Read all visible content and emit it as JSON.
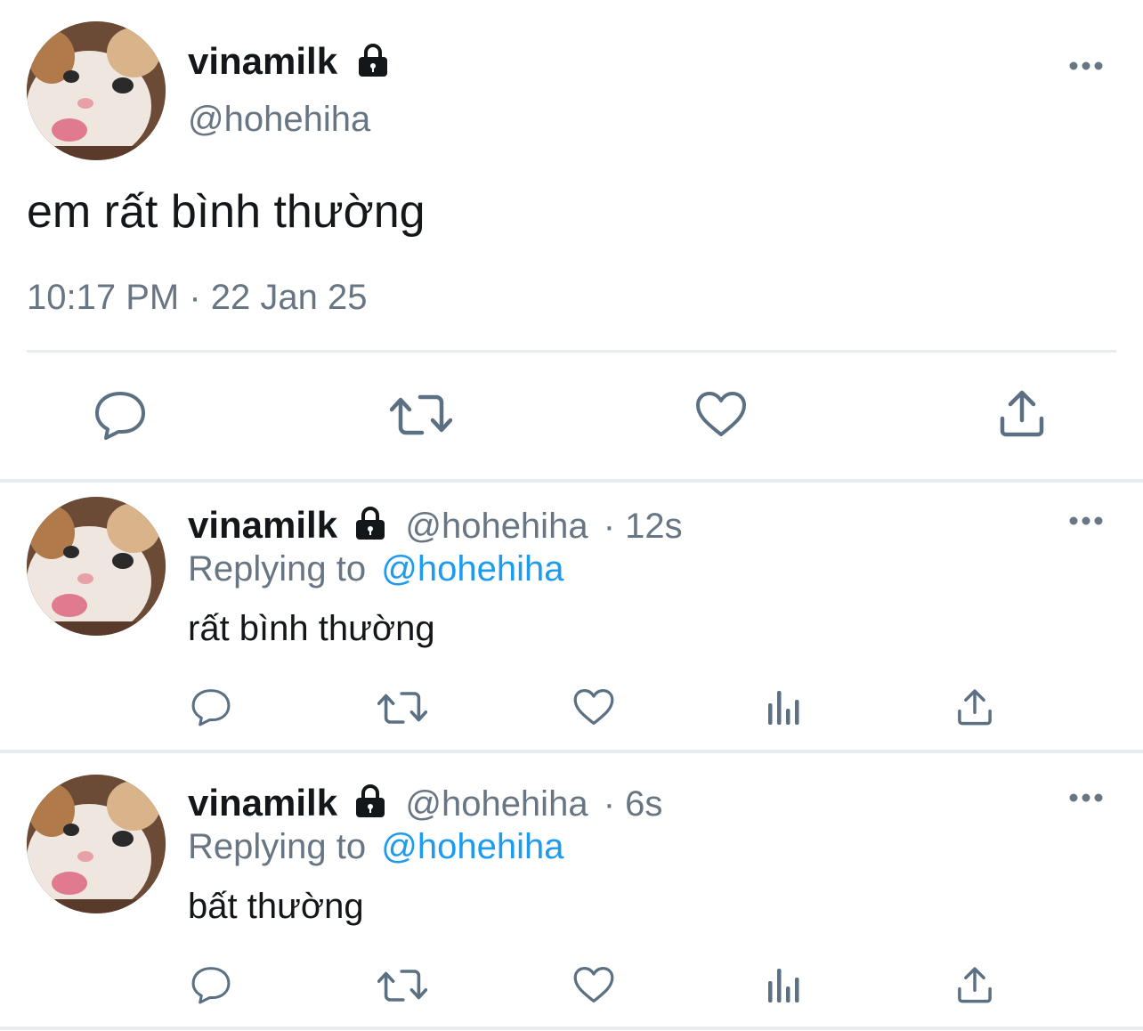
{
  "main_tweet": {
    "display_name": "vinamilk",
    "handle": "@hohehiha",
    "text": "em rất bình thường",
    "timestamp": "10:17 PM · 22 Jan 25",
    "locked": true,
    "actions": [
      "reply-icon",
      "retweet-icon",
      "like-icon",
      "share-icon"
    ]
  },
  "replies": [
    {
      "display_name": "vinamilk",
      "handle": "@hohehiha",
      "age": "· 12s",
      "replying_prefix": "Replying to",
      "replying_to": "@hohehiha",
      "text": "rất bình thường",
      "actions": [
        "reply-icon",
        "retweet-icon",
        "like-icon",
        "views-icon",
        "share-icon"
      ]
    },
    {
      "display_name": "vinamilk",
      "handle": "@hohehiha",
      "age": "· 6s",
      "replying_prefix": "Replying to",
      "replying_to": "@hohehiha",
      "text": "bất thường",
      "actions": [
        "reply-icon",
        "retweet-icon",
        "like-icon",
        "views-icon",
        "share-icon"
      ]
    }
  ],
  "colors": {
    "text": "#14171a",
    "muted": "#687684",
    "link": "#1d9bf0",
    "icon": "#5b7083",
    "divider": "#e9ecef"
  }
}
